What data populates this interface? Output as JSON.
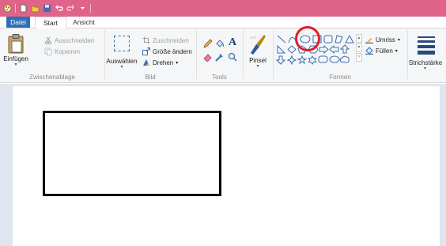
{
  "tabs": {
    "file": "Datei",
    "start": "Start",
    "view": "Ansicht"
  },
  "clipboard": {
    "paste": "Einfügen",
    "cut": "Ausschneiden",
    "copy": "Kopieren",
    "group_label": "Zwischenablage"
  },
  "image": {
    "select": "Auswählen",
    "crop": "Zuschneiden",
    "resize": "Größe ändern",
    "rotate": "Drehen",
    "group_label": "Bild"
  },
  "tools": {
    "group_label": "Tools",
    "text_glyph": "A"
  },
  "brush": {
    "label": "Pinsel"
  },
  "shapes": {
    "outline": "Umriss",
    "fill": "Füllen",
    "group_label": "Formen"
  },
  "size": {
    "label": "Strichstärke"
  },
  "colors": {
    "title_bar": "#e0648a",
    "file_tab": "#2f6fb7",
    "highlight_circle": "#e41e26"
  }
}
